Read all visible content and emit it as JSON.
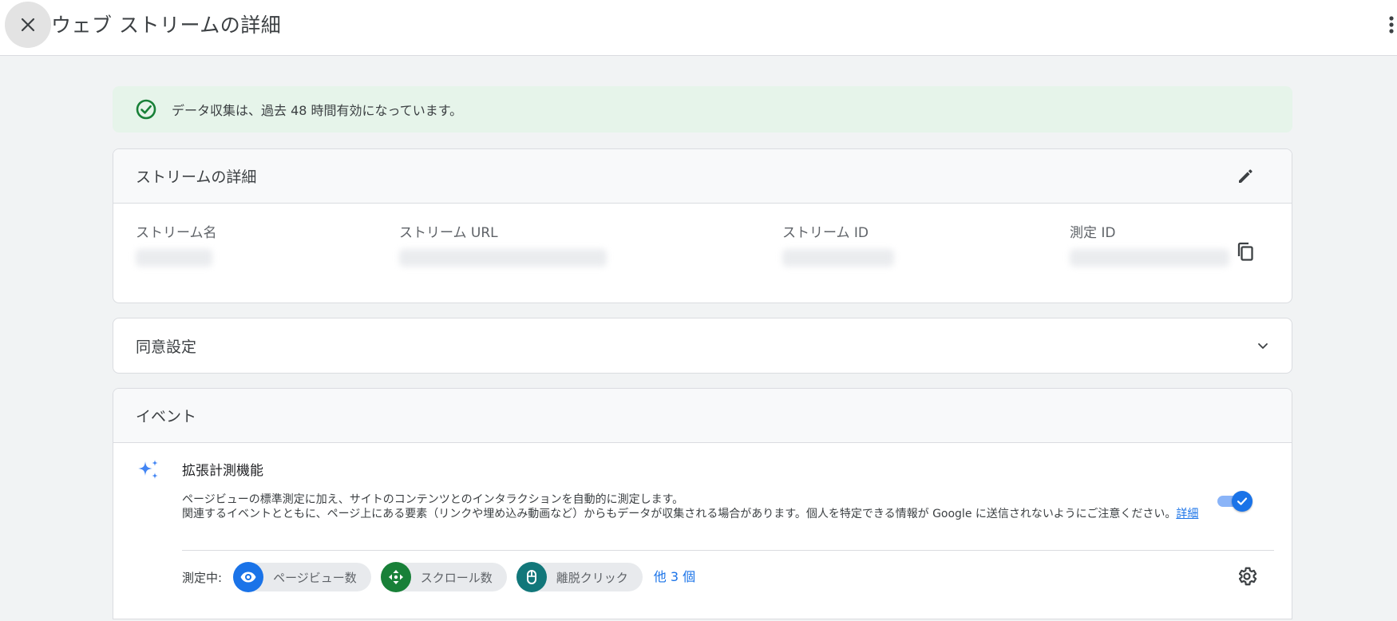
{
  "header": {
    "title": "ウェブ ストリームの詳細"
  },
  "banner": {
    "message": "データ収集は、過去 48 時間有効になっています。",
    "color": "#e6f4ea",
    "icon": "check-circle-icon"
  },
  "stream_details": {
    "title": "ストリームの詳細",
    "fields": [
      {
        "label": "ストリーム名"
      },
      {
        "label": "ストリーム URL"
      },
      {
        "label": "ストリーム ID"
      },
      {
        "label": "測定 ID"
      }
    ]
  },
  "consent": {
    "title": "同意設定"
  },
  "events": {
    "title": "イベント",
    "enhanced": {
      "title": "拡張計測機能",
      "description_line1": "ページビューの標準測定に加え、サイトのコンテンツとのインタラクションを自動的に測定します。",
      "description_line2": "関連するイベントとともに、ページ上にある要素（リンクや埋め込み動画など）からもデータが収集される場合があります。個人を特定できる情報が Google に送信されないようにご注意ください。",
      "learn_more": "詳細",
      "enabled": true,
      "measuring_label": "測定中:",
      "chips": [
        {
          "label": "ページビュー数",
          "icon": "eye-icon",
          "color": "#1a73e8"
        },
        {
          "label": "スクロール数",
          "icon": "scroll-arrows-icon",
          "color": "#188038"
        },
        {
          "label": "離脱クリック",
          "icon": "mouse-icon",
          "color": "#12777a"
        }
      ],
      "more_label": "他 3 個"
    }
  },
  "colors": {
    "accent": "#1a73e8",
    "success": "#188038",
    "background": "#f1f3f4"
  }
}
